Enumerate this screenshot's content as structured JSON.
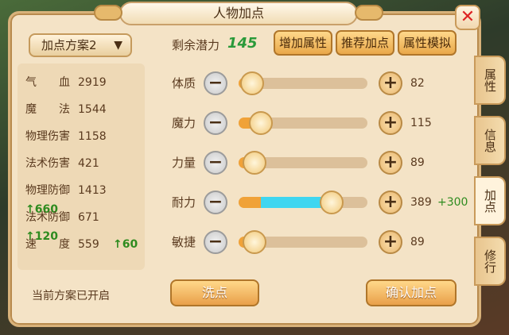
{
  "title": "人物加点",
  "close_icon": "close-x-icon",
  "plan": {
    "label": "加点方案2",
    "chevron": "▼"
  },
  "potential": {
    "label": "剩余潜力",
    "value": "145"
  },
  "top_buttons": [
    "增加属性",
    "推荐加点",
    "属性模拟"
  ],
  "stats": [
    {
      "label": "气　　血",
      "value": "2919",
      "bonus": ""
    },
    {
      "label": "魔　　法",
      "value": "1544",
      "bonus": ""
    },
    {
      "label": "物理伤害",
      "value": "1158",
      "bonus": ""
    },
    {
      "label": "法术伤害",
      "value": "421",
      "bonus": ""
    },
    {
      "label": "物理防御",
      "value": "1413",
      "bonus": "↑660"
    },
    {
      "label": "法术防御",
      "value": "671",
      "bonus": "↑120"
    },
    {
      "label": "速　　度",
      "value": "559",
      "bonus": "↑60"
    }
  ],
  "status_text": "当前方案已开启",
  "attributes": [
    {
      "label": "体质",
      "value": "82",
      "bonus": "",
      "fill_fraction": 0.08,
      "extra_fraction": 0
    },
    {
      "label": "魔力",
      "value": "115",
      "bonus": "",
      "fill_fraction": 0.15,
      "extra_fraction": 0
    },
    {
      "label": "力量",
      "value": "89",
      "bonus": "",
      "fill_fraction": 0.1,
      "extra_fraction": 0
    },
    {
      "label": "耐力",
      "value": "389",
      "bonus": "+300",
      "fill_fraction": 0.17,
      "extra_fraction": 0.53
    },
    {
      "label": "敏捷",
      "value": "89",
      "bonus": "",
      "fill_fraction": 0.1,
      "extra_fraction": 0
    }
  ],
  "bottom_buttons": {
    "reset": "洗点",
    "confirm": "确认加点"
  },
  "side_tabs": [
    "属性",
    "信息",
    "加点",
    "修行"
  ],
  "active_tab": "加点"
}
